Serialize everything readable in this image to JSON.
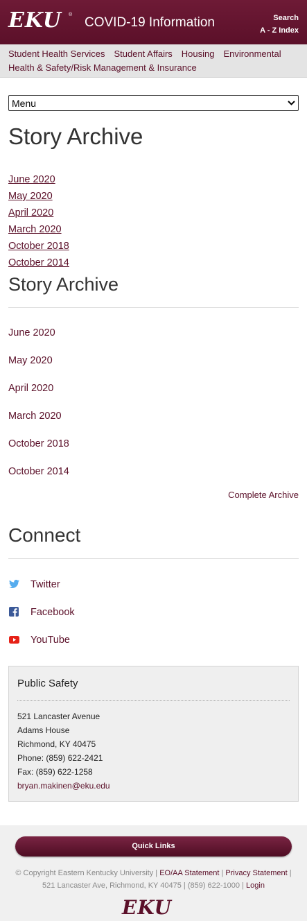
{
  "header": {
    "logo": "EKU",
    "logo_mark": "®",
    "title": "COVID-19 Information",
    "links": [
      "Search",
      "A - Z Index"
    ]
  },
  "subnav": {
    "items": [
      "Student Health Services",
      "Student Affairs",
      "Housing",
      "Environmental Health & Safety/Risk Management & Insurance"
    ]
  },
  "menu": {
    "label": "Menu",
    "icon": "chevron-down-icon"
  },
  "archive_primary": {
    "title": "Story Archive",
    "items": [
      "June 2020",
      "May 2020",
      "April 2020",
      "March 2020",
      "October 2018",
      "October 2014"
    ]
  },
  "archive_secondary": {
    "title": "Story Archive",
    "items": [
      "June 2020",
      "May 2020",
      "April 2020",
      "March 2020",
      "October 2018",
      "October 2014"
    ],
    "complete_label": "Complete Archive"
  },
  "connect": {
    "title": "Connect",
    "items": [
      {
        "label": "Twitter",
        "icon": "twitter-icon",
        "color": "#55acee"
      },
      {
        "label": "Facebook",
        "icon": "facebook-icon",
        "color": "#3b5998"
      },
      {
        "label": "YouTube",
        "icon": "youtube-icon",
        "color": "#e62117"
      }
    ]
  },
  "contact": {
    "title": "Public Safety",
    "lines": [
      "521 Lancaster Avenue",
      "Adams House",
      "Richmond, KY 40475",
      "Phone: (859) 622-2421",
      "Fax: (859) 622-1258"
    ],
    "email": "bryan.makinen@eku.edu"
  },
  "footer": {
    "quick_links": "Quick Links",
    "copyright": "© Copyright Eastern Kentucky University",
    "sep": "|",
    "eo_link": "EO/AA Statement",
    "privacy_link": "Privacy Statement",
    "address": "521 Lancaster Ave, Richmond, KY 40475",
    "phone": "(859) 622-1000",
    "login_link": "Login",
    "logo": "EKU"
  },
  "colors": {
    "brand": "#5b1029",
    "brand_light": "#6e1a36",
    "subnav_bg": "#e4e4e4"
  }
}
